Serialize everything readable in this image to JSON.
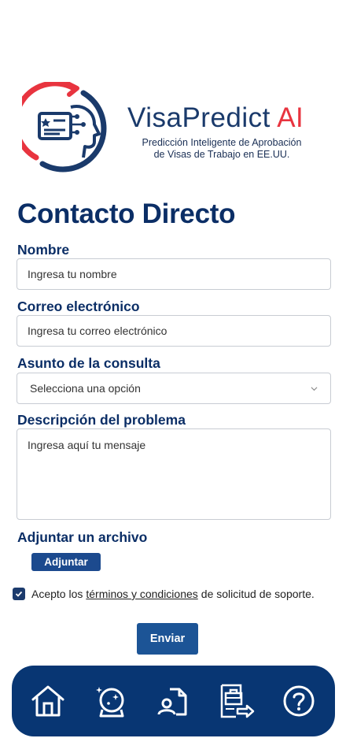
{
  "brand": {
    "name": "VisaPredict",
    "name_suffix": "AI",
    "tagline_line1": "Predicción Inteligente de Aprobación",
    "tagline_line2": "de Visas de Trabajo en EE.UU.",
    "colors": {
      "navy": "#1a3a6b",
      "red": "#e8343f"
    }
  },
  "page": {
    "title": "Contacto Directo"
  },
  "form": {
    "name_label": "Nombre",
    "name_placeholder": "Ingresa tu nombre",
    "email_label": "Correo electrónico",
    "email_placeholder": "Ingresa tu correo electrónico",
    "subject_label": "Asunto de la consulta",
    "subject_selected": "Selecciona una opción",
    "description_label": "Descripción del problema",
    "description_placeholder": "Ingresa aquí tu mensaje",
    "attach_label": "Adjuntar un archivo",
    "attach_button": "Adjuntar",
    "consent_prefix": "Acepto los",
    "consent_link": "términos y condiciones",
    "consent_suffix": "de solicitud de soporte.",
    "consent_checked": true,
    "submit_button": "Enviar"
  },
  "nav": {
    "items": [
      {
        "icon": "home-icon"
      },
      {
        "icon": "crystal-ball-icon"
      },
      {
        "icon": "user-document-icon"
      },
      {
        "icon": "briefcase-document-icon"
      },
      {
        "icon": "help-icon"
      }
    ],
    "background": "#083673"
  }
}
